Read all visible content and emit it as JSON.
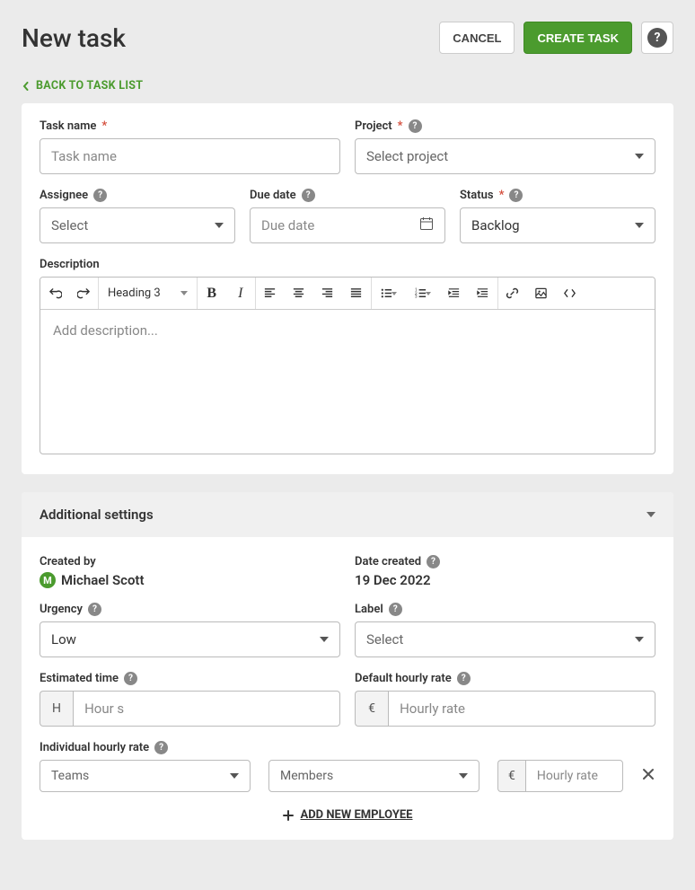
{
  "header": {
    "title": "New task",
    "cancel": "CANCEL",
    "create": "CREATE TASK",
    "back_link": "BACK TO TASK LIST"
  },
  "form": {
    "task_name": {
      "label": "Task name",
      "placeholder": "Task name"
    },
    "project": {
      "label": "Project",
      "placeholder": "Select project"
    },
    "assignee": {
      "label": "Assignee",
      "placeholder": "Select"
    },
    "due_date": {
      "label": "Due date",
      "placeholder": "Due date"
    },
    "status": {
      "label": "Status",
      "value": "Backlog"
    },
    "description": {
      "label": "Description",
      "placeholder": "Add description...",
      "heading_style": "Heading 3"
    }
  },
  "additional": {
    "title": "Additional settings",
    "created_by": {
      "label": "Created by",
      "avatar_initial": "M",
      "name": "Michael Scott"
    },
    "date_created": {
      "label": "Date created",
      "value": "19 Dec 2022"
    },
    "urgency": {
      "label": "Urgency",
      "value": "Low"
    },
    "label_field": {
      "label": "Label",
      "placeholder": "Select"
    },
    "estimated_time": {
      "label": "Estimated time",
      "prefix": "H",
      "placeholder": "Hour s"
    },
    "default_rate": {
      "label": "Default hourly rate",
      "prefix": "€",
      "placeholder": "Hourly rate"
    },
    "individual_rate": {
      "label": "Individual hourly rate",
      "teams_placeholder": "Teams",
      "members_placeholder": "Members",
      "rate_prefix": "€",
      "rate_placeholder": "Hourly rate"
    },
    "add_employee": "ADD NEW EMPLOYEE"
  }
}
